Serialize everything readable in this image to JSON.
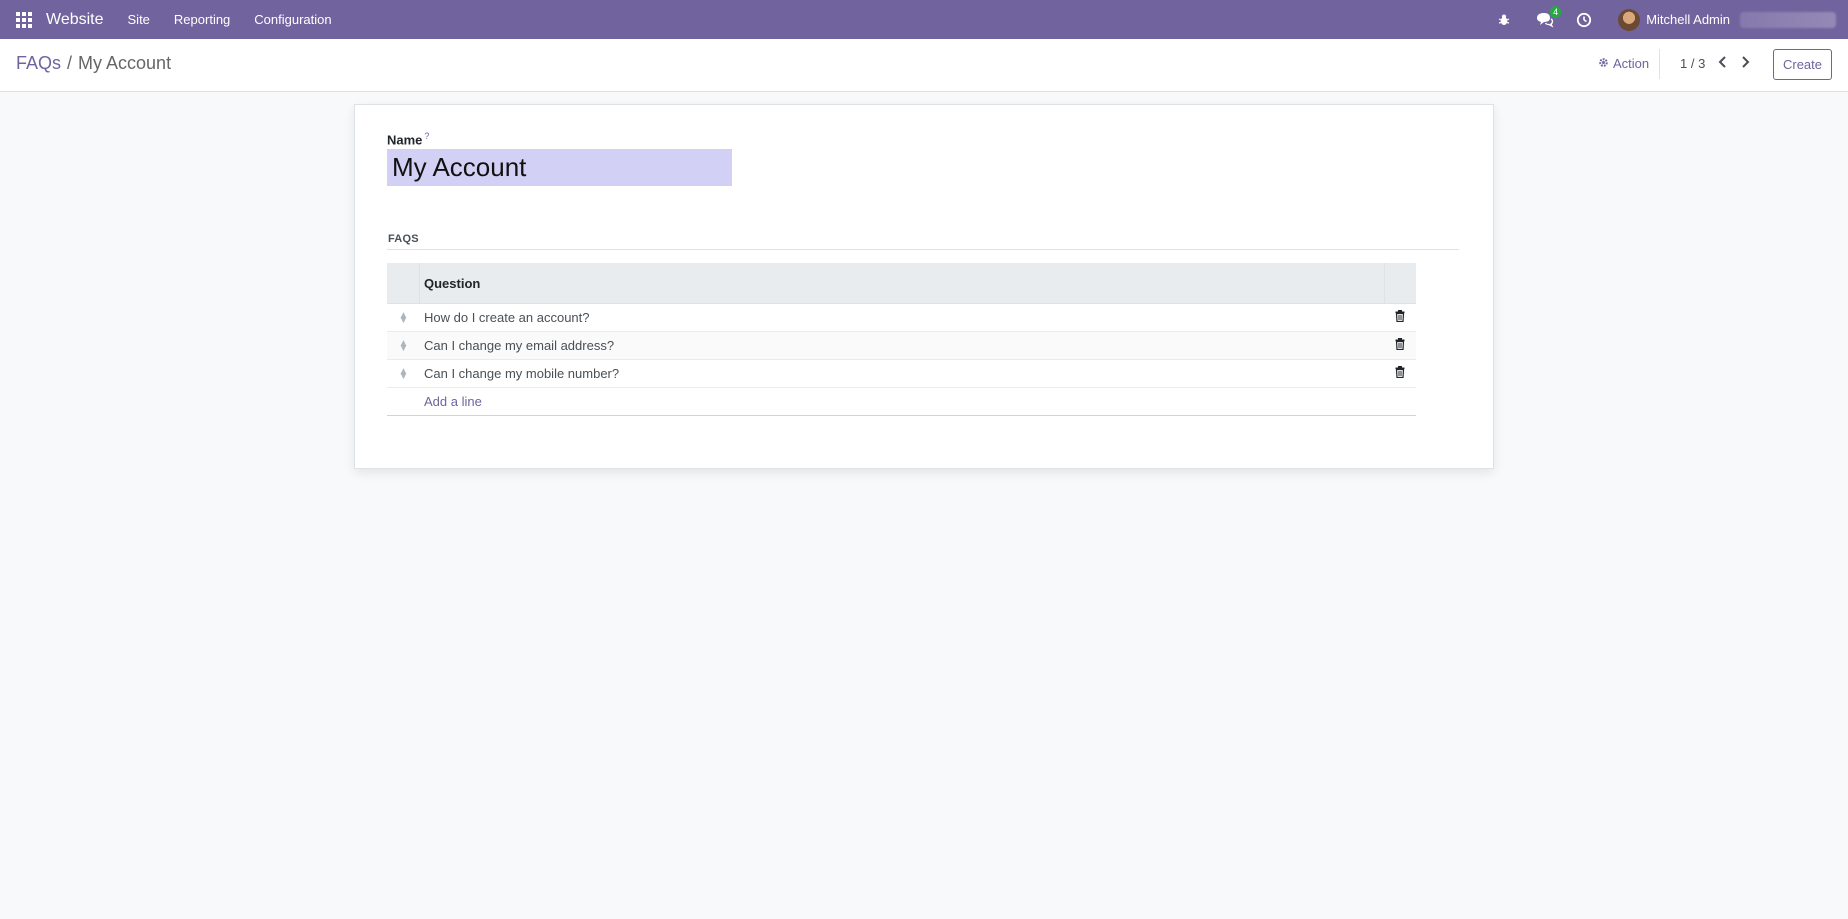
{
  "navbar": {
    "brand": "Website",
    "menu": [
      "Site",
      "Reporting",
      "Configuration"
    ],
    "messages_badge": "4",
    "user_name": "Mitchell Admin"
  },
  "control": {
    "breadcrumb_parent": "FAQs",
    "breadcrumb_sep": "/",
    "breadcrumb_current": "My Account",
    "action_label": "Action",
    "pager": "1 / 3",
    "create_label": "Create"
  },
  "form": {
    "name_label": "Name",
    "help_mark": "?",
    "name_value": "My Account",
    "section_title": "FAQS",
    "column_question": "Question",
    "rows": [
      "How do I create an account?",
      "Can I change my email address?",
      "Can I change my mobile number?"
    ],
    "add_line": "Add a line"
  },
  "colors": {
    "brand_purple": "#71639e",
    "input_highlight": "#d2d1f5",
    "badge_green": "#28a745"
  },
  "icons": {
    "apps": "apps-grid-icon",
    "bug": "bug-icon",
    "chat": "chat-icon",
    "clock": "clock-icon",
    "gear": "gear-icon",
    "prev": "chevron-left-icon",
    "next": "chevron-right-icon",
    "trash": "trash-icon",
    "handle": "drag-handle-icon"
  }
}
